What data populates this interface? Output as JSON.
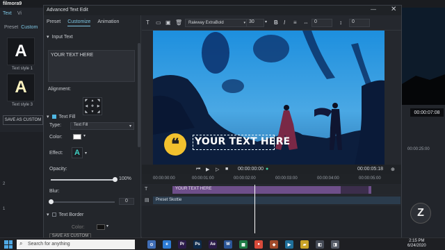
{
  "app": {
    "logo": "filmora9",
    "top_tabs": [
      "Text",
      "Vi"
    ],
    "sub_tabs": [
      "Preset",
      "Custom"
    ],
    "style_cards": [
      {
        "glyph": "A",
        "label": "Text style 1"
      },
      {
        "glyph": "A",
        "label": "Text style 3"
      }
    ],
    "save_as_custom": "SAVE AS CUSTOM",
    "right_time": "00:00:07:08",
    "right_ruler": "00:00:25:00",
    "track_labels": [
      "2",
      "1"
    ]
  },
  "dialog": {
    "title": "Advanced Text Edit",
    "minimize_icon": "—",
    "close_icon": "✕",
    "tabs": [
      "Preset",
      "Customize",
      "Animation"
    ],
    "input_text_label": "Input Text",
    "input_text_value": "YOUR TEXT HERE",
    "alignment_label": "Alignment:",
    "text_fill_label": "Text Fill",
    "type_label": "Type:",
    "type_value": "Text Fill",
    "color_label": "Color:",
    "color_value": "#ffffff",
    "effect_label": "Effect:",
    "effect_glyph": "A",
    "opacity_label": "Opacity:",
    "opacity_value": "100%",
    "opacity_fraction": 1.0,
    "blur_label": "Blur:",
    "blur_value": "0",
    "blur_fraction": 0.0,
    "text_border_label": "Text Border",
    "border_color_label": "Color:",
    "save_custom_label": "SAVE AS CUSTOM"
  },
  "toolbar": {
    "font": "Raleway ExtraBold",
    "size": "30",
    "spacing_value": "0",
    "line_value": "0"
  },
  "preview": {
    "title_text": "YOUR TEXT HERE",
    "quote_glyph": "❝"
  },
  "playback": {
    "current_time": "00:00:00:00",
    "duration": "00:00:05:18",
    "ruler": [
      "00:00:00:00",
      "00:00:01:00",
      "00:00:02:00",
      "00:00:03:00",
      "00:00:04:00",
      "00:00:05:00"
    ]
  },
  "timeline": {
    "text_clip_label": "YOUR TEXT HERE",
    "preset_clip_label": "Preset Skottie"
  },
  "taskbar": {
    "search_placeholder": "Search for anything",
    "time": "2:15 PM",
    "date": "6/24/2020",
    "apps": [
      {
        "label": "⊙",
        "color": "#3f6db6"
      },
      {
        "label": "e",
        "color": "#2d7cd6"
      },
      {
        "label": "Pr",
        "color": "#2b1b4a"
      },
      {
        "label": "Ps",
        "color": "#0d2a4a"
      },
      {
        "label": "Ae",
        "color": "#2b1b4a"
      },
      {
        "label": "W",
        "color": "#2b5597"
      },
      {
        "label": "▦",
        "color": "#1f7a46"
      },
      {
        "label": "●",
        "color": "#d84a3a"
      },
      {
        "label": "◆",
        "color": "#a24a2a"
      },
      {
        "label": "▶",
        "color": "#1f6f9a"
      },
      {
        "label": "▰",
        "color": "#c9a227"
      },
      {
        "label": "◧",
        "color": "#444a55"
      },
      {
        "label": "◨",
        "color": "#555b66"
      }
    ]
  },
  "colors": {
    "accent": "#4fb7e3",
    "title_bar": "#1f2226",
    "quote_yellow": "#f2c12e",
    "text_clip": "#6e4f8a"
  }
}
